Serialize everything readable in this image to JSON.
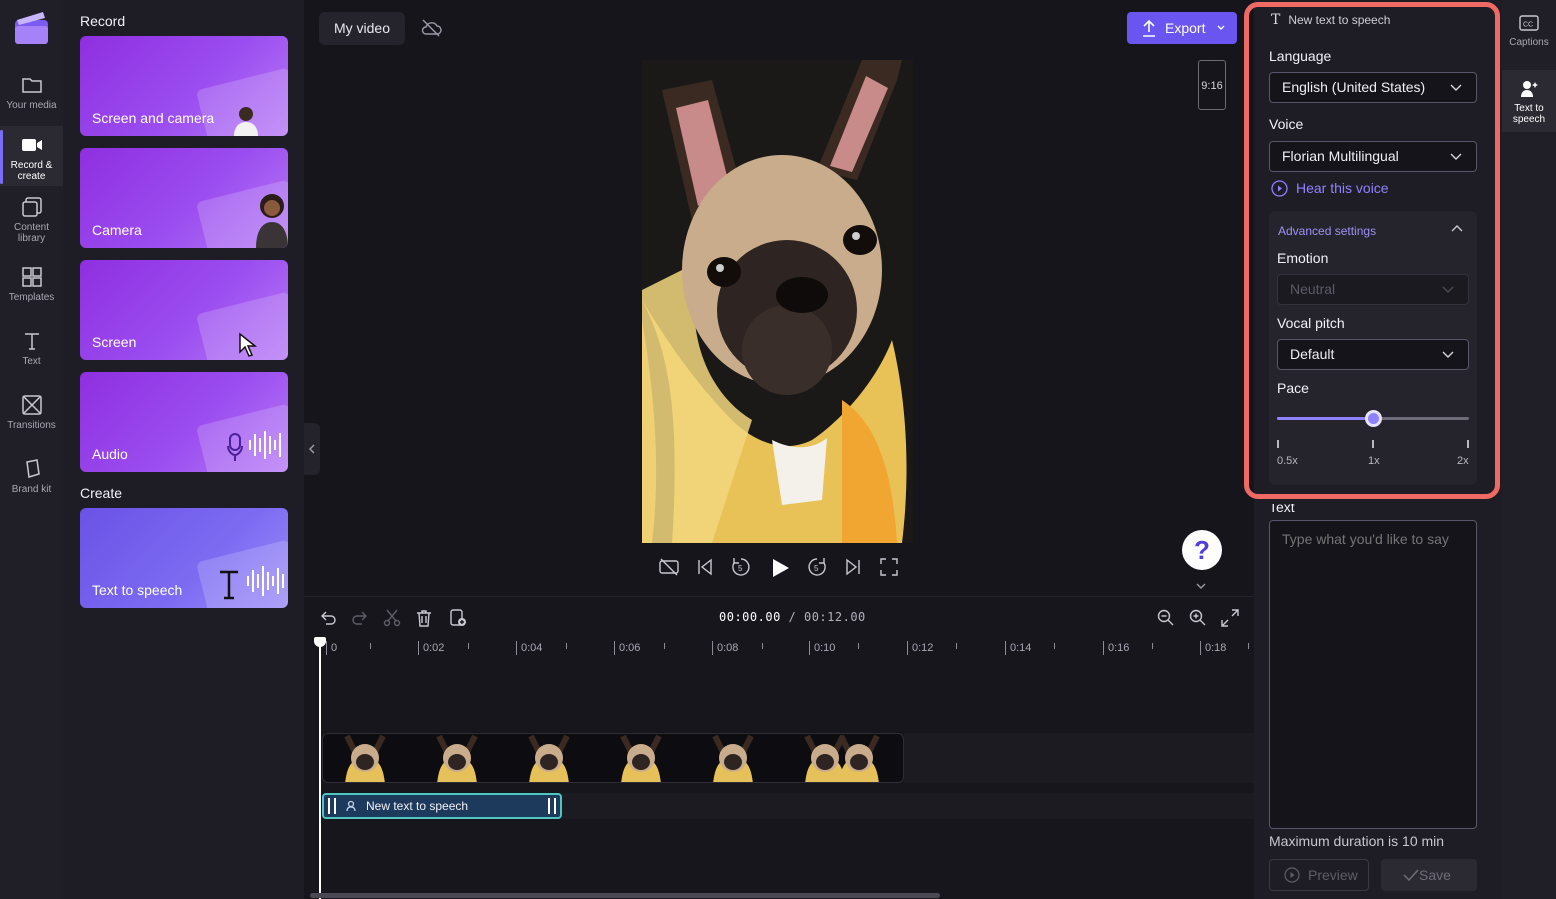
{
  "nav": {
    "items": [
      {
        "label": "Your media"
      },
      {
        "label": "Record &\ncreate"
      },
      {
        "label": "Content\nlibrary"
      },
      {
        "label": "Templates"
      },
      {
        "label": "Text"
      },
      {
        "label": "Transitions"
      },
      {
        "label": "Brand kit"
      }
    ]
  },
  "panel": {
    "record_title": "Record",
    "create_title": "Create",
    "cards": [
      {
        "label": "Screen and camera"
      },
      {
        "label": "Camera"
      },
      {
        "label": "Screen"
      },
      {
        "label": "Audio"
      },
      {
        "label": "Text to speech"
      }
    ]
  },
  "header": {
    "project_title": "My video",
    "export_label": "Export",
    "aspect_ratio": "9:16"
  },
  "timeline": {
    "current_time": "00:00.00",
    "total_time": "/ 00:12.00",
    "ticks": [
      "0",
      "0:02",
      "0:04",
      "0:06",
      "0:08",
      "0:10",
      "0:12",
      "0:14",
      "0:16",
      "0:18"
    ],
    "audio_clip_label": "New text to speech"
  },
  "tts_panel": {
    "header": "New text to speech",
    "language_label": "Language",
    "language_value": "English (United States)",
    "voice_label": "Voice",
    "voice_value": "Florian Multilingual",
    "hear_voice": "Hear this voice",
    "advanced_title": "Advanced settings",
    "emotion_label": "Emotion",
    "emotion_value": "Neutral",
    "pitch_label": "Vocal pitch",
    "pitch_value": "Default",
    "pace_label": "Pace",
    "pace_fraction": 0.5,
    "pace_marks": [
      "0.5x",
      "1x",
      "2x"
    ],
    "text_label": "Text",
    "text_placeholder": "Type what you'd like to say",
    "max_duration": "Maximum duration is 10 min",
    "preview_label": "Preview",
    "save_label": "Save"
  },
  "rail": {
    "items": [
      {
        "label": "Captions"
      },
      {
        "label": "Text to\nspeech"
      }
    ]
  },
  "colors": {
    "accent": "#6a55f0",
    "link": "#8f82ff",
    "highlight": "#ef6a64",
    "audio_clip_border": "#4fc6c0"
  }
}
